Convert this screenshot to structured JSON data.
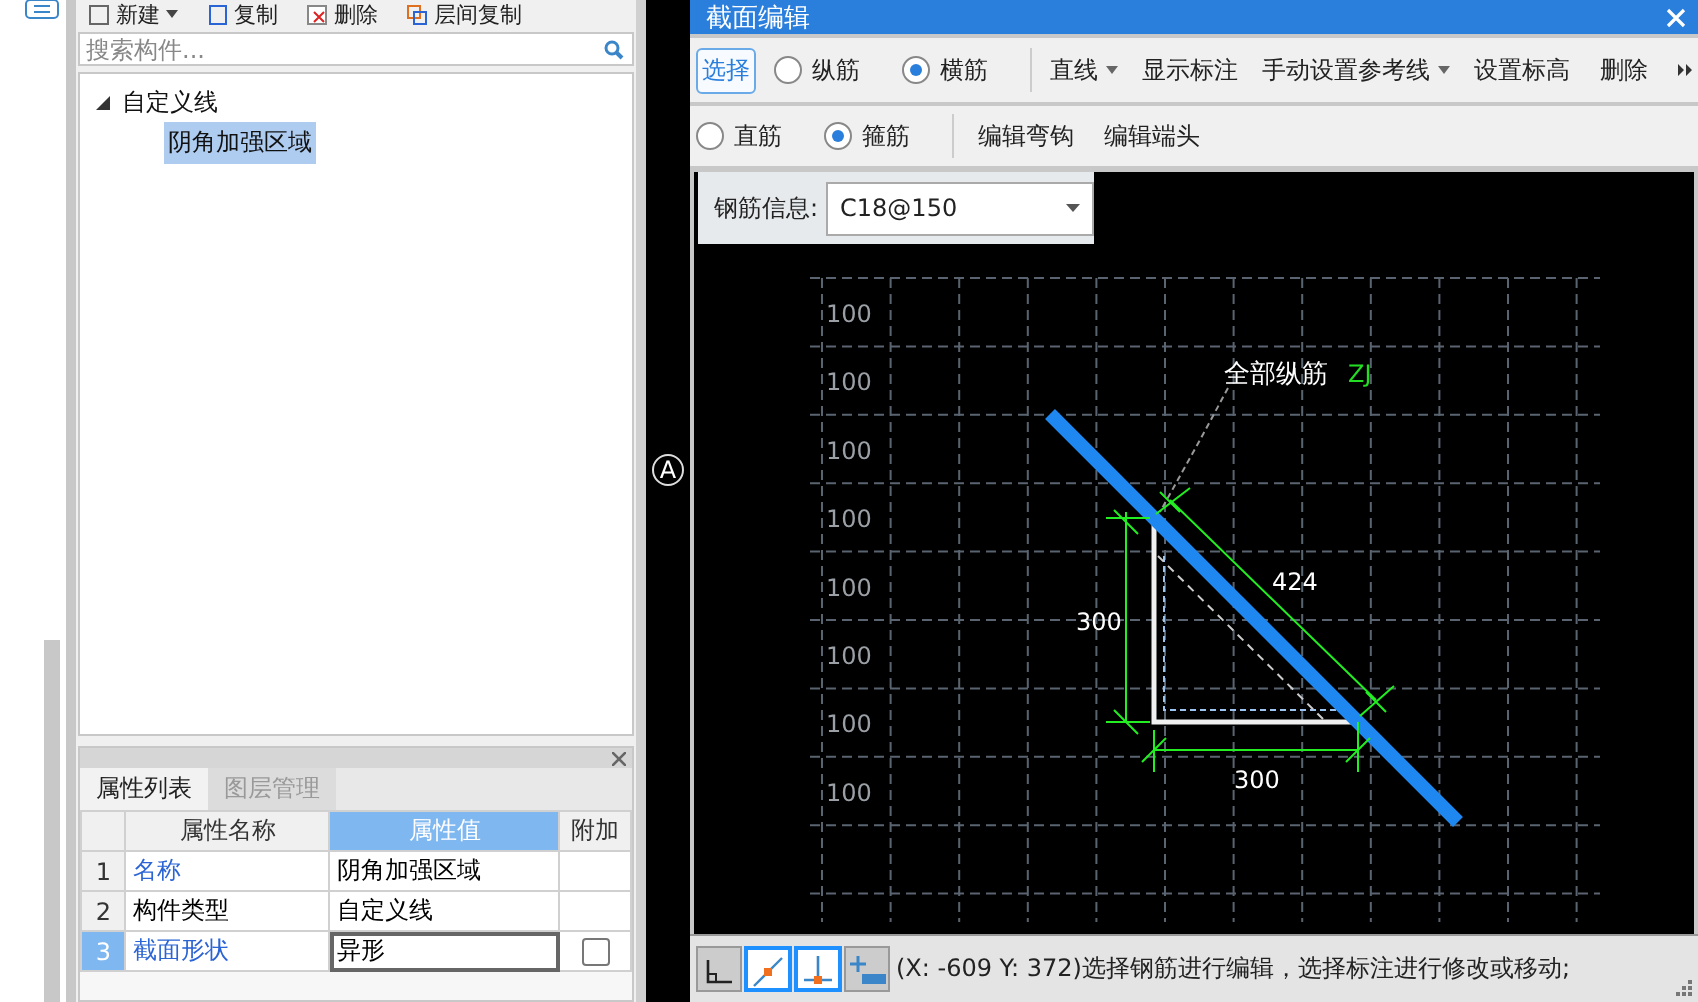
{
  "left_toolbar": [
    {
      "label": "新建",
      "dropdown": true
    },
    {
      "label": "复制",
      "dropdown": false
    },
    {
      "label": "删除",
      "dropdown": false
    },
    {
      "label": "层间复制",
      "dropdown": false
    }
  ],
  "search": {
    "placeholder": "搜索构件..."
  },
  "tree": [
    {
      "label": "自定义线",
      "expanded": true,
      "selected": false,
      "children": [
        {
          "label": "阴角加强区域",
          "selected": true
        }
      ]
    }
  ],
  "property_panel": {
    "tabs": [
      {
        "label": "属性列表",
        "selected": true
      },
      {
        "label": "图层管理",
        "selected": false
      }
    ],
    "columns": [
      "属性名称",
      "属性值",
      "附加"
    ],
    "rows": [
      {
        "index": "1",
        "name": "名称",
        "value": "阴角加强区域",
        "link": true,
        "selected": false
      },
      {
        "index": "2",
        "name": "构件类型",
        "value": "自定义线",
        "link": false,
        "selected": false
      },
      {
        "index": "3",
        "name": "截面形状",
        "value": "异形",
        "link": true,
        "checkbox": {
          "checked": false
        },
        "selected": true
      }
    ]
  },
  "axis_marker": "A",
  "dialog": {
    "title": "截面编辑",
    "toolbar_1": [
      {
        "kind": "button",
        "label": "选择",
        "selected": true
      },
      {
        "kind": "radio",
        "label": "纵筋",
        "checked": false
      },
      {
        "kind": "radio",
        "label": "横筋",
        "checked": true
      },
      {
        "kind": "separator"
      },
      {
        "kind": "dropdown",
        "label": "直线"
      },
      {
        "kind": "button",
        "label": "显示标注",
        "selected": false
      },
      {
        "kind": "dropdown",
        "label": "手动设置参考线"
      },
      {
        "kind": "button",
        "label": "设置标高",
        "selected": false
      },
      {
        "kind": "button",
        "label": "删除",
        "selected": false
      }
    ],
    "toolbar_2": [
      {
        "kind": "radio",
        "label": "直筋",
        "checked": false
      },
      {
        "kind": "radio",
        "label": "箍筋",
        "checked": true
      },
      {
        "kind": "separator"
      },
      {
        "kind": "button",
        "label": "编辑弯钩",
        "selected": false
      },
      {
        "kind": "button",
        "label": "编辑端头",
        "selected": false
      }
    ],
    "rebar_info": {
      "label": "钢筋信息:",
      "value": "C18@150"
    },
    "canvas": {
      "grid_labels": [
        "100",
        "100",
        "100",
        "100",
        "100",
        "100",
        "100",
        "100"
      ],
      "annotation": "全部纵筋",
      "annotation_code": "ZJ",
      "diagonal_dimension": "424",
      "vertical_dimension": "300",
      "horizontal_dimension": "300"
    },
    "status_bar": {
      "tools": [
        {
          "kind": "corner",
          "selected": false
        },
        {
          "kind": "line",
          "selected": true
        },
        {
          "kind": "perpendicular",
          "selected": true
        },
        {
          "kind": "add",
          "selected": false
        }
      ],
      "message": "(X: -609 Y: 372)选择钢筋进行编辑，选择标注进行修改或移动;"
    }
  }
}
